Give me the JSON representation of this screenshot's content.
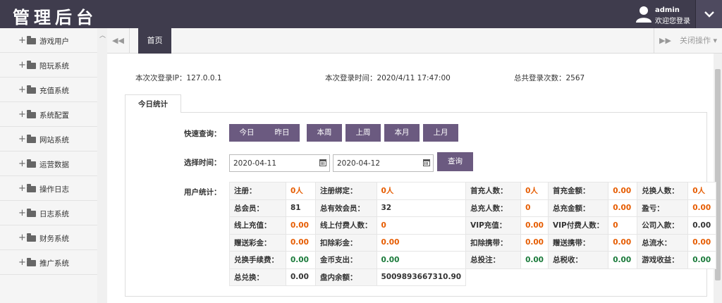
{
  "header": {
    "logo": "管理后台",
    "user_name": "admin",
    "welcome": "欢迎您登录"
  },
  "sidebar": {
    "items": [
      {
        "label": "游戏用户"
      },
      {
        "label": "陪玩系统"
      },
      {
        "label": "充值系统"
      },
      {
        "label": "系统配置"
      },
      {
        "label": "网站系统"
      },
      {
        "label": "运营数据"
      },
      {
        "label": "操作日志"
      },
      {
        "label": "日志系统"
      },
      {
        "label": "财务系统"
      },
      {
        "label": "推广系统"
      }
    ]
  },
  "tabs": {
    "home": "首页",
    "close_ops": "关闭操作"
  },
  "login_info": {
    "ip": "本次次登录IP：127.0.0.1",
    "time": "本次登录时间：2020/4/11 17:47:00",
    "count": "总共登录次数：2567"
  },
  "panel": {
    "tab": "今日统计",
    "quick_query_label": "快速查询：",
    "quick_buttons": [
      "今日",
      "昨日",
      "本周",
      "上周",
      "本月",
      "上月"
    ],
    "select_time_label": "选择时间：",
    "start_date": "2020-04-11",
    "end_date": "2020-04-12",
    "search_button": "查询",
    "user_stats_label": "用户统计："
  },
  "colors": {
    "header_bg": "#3f3c4d",
    "button_bg": "#6b5a80",
    "value_orange": "#e65c00",
    "value_green": "#1a7a3a"
  },
  "stats": [
    [
      {
        "k": "注册：",
        "v": "0人",
        "c": "orange"
      },
      {
        "k": "注册绑定：",
        "v": "0人",
        "c": "orange"
      },
      {
        "k": "首充人数：",
        "v": "0人",
        "c": "orange"
      },
      {
        "k": "首充金额：",
        "v": "0.00",
        "c": "orange"
      },
      {
        "k": "兑换人数：",
        "v": "0人",
        "c": "orange"
      }
    ],
    [
      {
        "k": "总会员：",
        "v": "81",
        "c": "dark"
      },
      {
        "k": "总有效会员：",
        "v": "32",
        "c": "dark"
      },
      {
        "k": "总充人数：",
        "v": "0",
        "c": "orange"
      },
      {
        "k": "总充金额：",
        "v": "0.00",
        "c": "orange"
      },
      {
        "k": "盈亏：",
        "v": "0.00",
        "c": "orange"
      }
    ],
    [
      {
        "k": "线上充值：",
        "v": "0.00",
        "c": "orange"
      },
      {
        "k": "线上付费人数：",
        "v": "0",
        "c": "orange"
      },
      {
        "k": "VIP充值：",
        "v": "0.00",
        "c": "orange"
      },
      {
        "k": "VIP付费人数：",
        "v": "0",
        "c": "orange"
      },
      {
        "k": "公司入款：",
        "v": "0.00",
        "c": "dark"
      }
    ],
    [
      {
        "k": "赠送彩金：",
        "v": "0.00",
        "c": "orange"
      },
      {
        "k": "扣除彩金：",
        "v": "0.00",
        "c": "orange"
      },
      {
        "k": "扣除携带：",
        "v": "0.00",
        "c": "orange"
      },
      {
        "k": "赠送携带：",
        "v": "0.00",
        "c": "orange"
      },
      {
        "k": "总流水：",
        "v": "0.00",
        "c": "orange"
      }
    ],
    [
      {
        "k": "兑换手续费：",
        "v": "0.00",
        "c": "green"
      },
      {
        "k": "金币支出：",
        "v": "0.00",
        "c": "green"
      },
      {
        "k": "总投注：",
        "v": "0.00",
        "c": "green"
      },
      {
        "k": "总税收：",
        "v": "0.00",
        "c": "green"
      },
      {
        "k": "游戏收益：",
        "v": "0.00",
        "c": "green"
      }
    ],
    [
      {
        "k": "总兑换：",
        "v": "0.00",
        "c": "dark"
      },
      {
        "k": "盘内余额：",
        "v": "5009893667310.90",
        "c": "dark"
      }
    ]
  ]
}
